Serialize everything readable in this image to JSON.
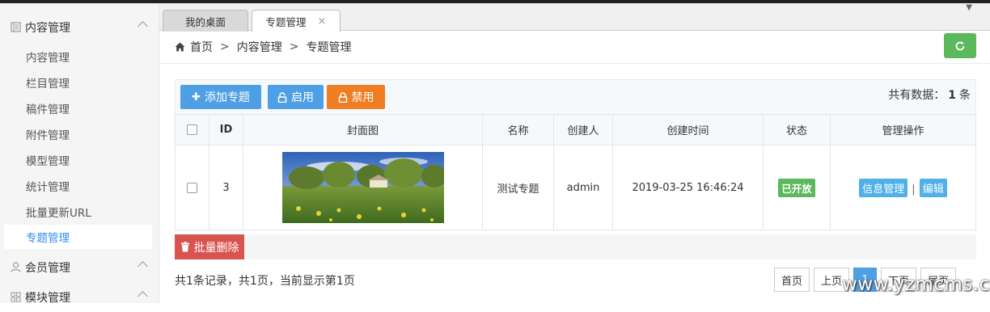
{
  "sidebar": {
    "groups": [
      {
        "label": "内容管理",
        "icon": "document-icon"
      },
      {
        "label": "会员管理",
        "icon": "user-icon"
      },
      {
        "label": "模块管理",
        "icon": "grid-icon"
      }
    ],
    "items": [
      {
        "label": "内容管理"
      },
      {
        "label": "栏目管理"
      },
      {
        "label": "稿件管理"
      },
      {
        "label": "附件管理"
      },
      {
        "label": "模型管理"
      },
      {
        "label": "统计管理"
      },
      {
        "label": "批量更新URL"
      },
      {
        "label": "专题管理",
        "active": true
      }
    ]
  },
  "tabs": [
    {
      "label": "我的桌面"
    },
    {
      "label": "专题管理",
      "close": "×"
    }
  ],
  "breadcrumb": {
    "home": "首页",
    "parent": "内容管理",
    "current": "专题管理",
    "sep": ">"
  },
  "toolbar": {
    "add_label": "添加专题",
    "enable_label": "启用",
    "disable_label": "禁用",
    "total_prefix": "共有数据：",
    "total_count": "1",
    "total_suffix": "条"
  },
  "table": {
    "headers": [
      "ID",
      "封面图",
      "名称",
      "创建人",
      "创建时间",
      "状态",
      "管理操作"
    ],
    "rows": [
      {
        "id": "3",
        "name": "测试专题",
        "creator": "admin",
        "created_at": "2019-03-25 16:46:24",
        "status": "已开放",
        "op_info": "信息管理",
        "op_sep": "|",
        "op_edit": "编辑"
      }
    ]
  },
  "footer": {
    "batch_delete": "批量删除",
    "records_text": "共1条记录，共1页，当前显示第1页",
    "pager": {
      "first": "首页",
      "prev": "上页",
      "current": "1",
      "next": "下页",
      "last": "尾页"
    }
  },
  "watermark": "www.yzmcms.com",
  "colors": {
    "primary": "#4f9fe5",
    "warning": "#f07d22",
    "danger": "#d9534f",
    "success": "#5cb85c",
    "active_link": "#2d8cf0"
  }
}
